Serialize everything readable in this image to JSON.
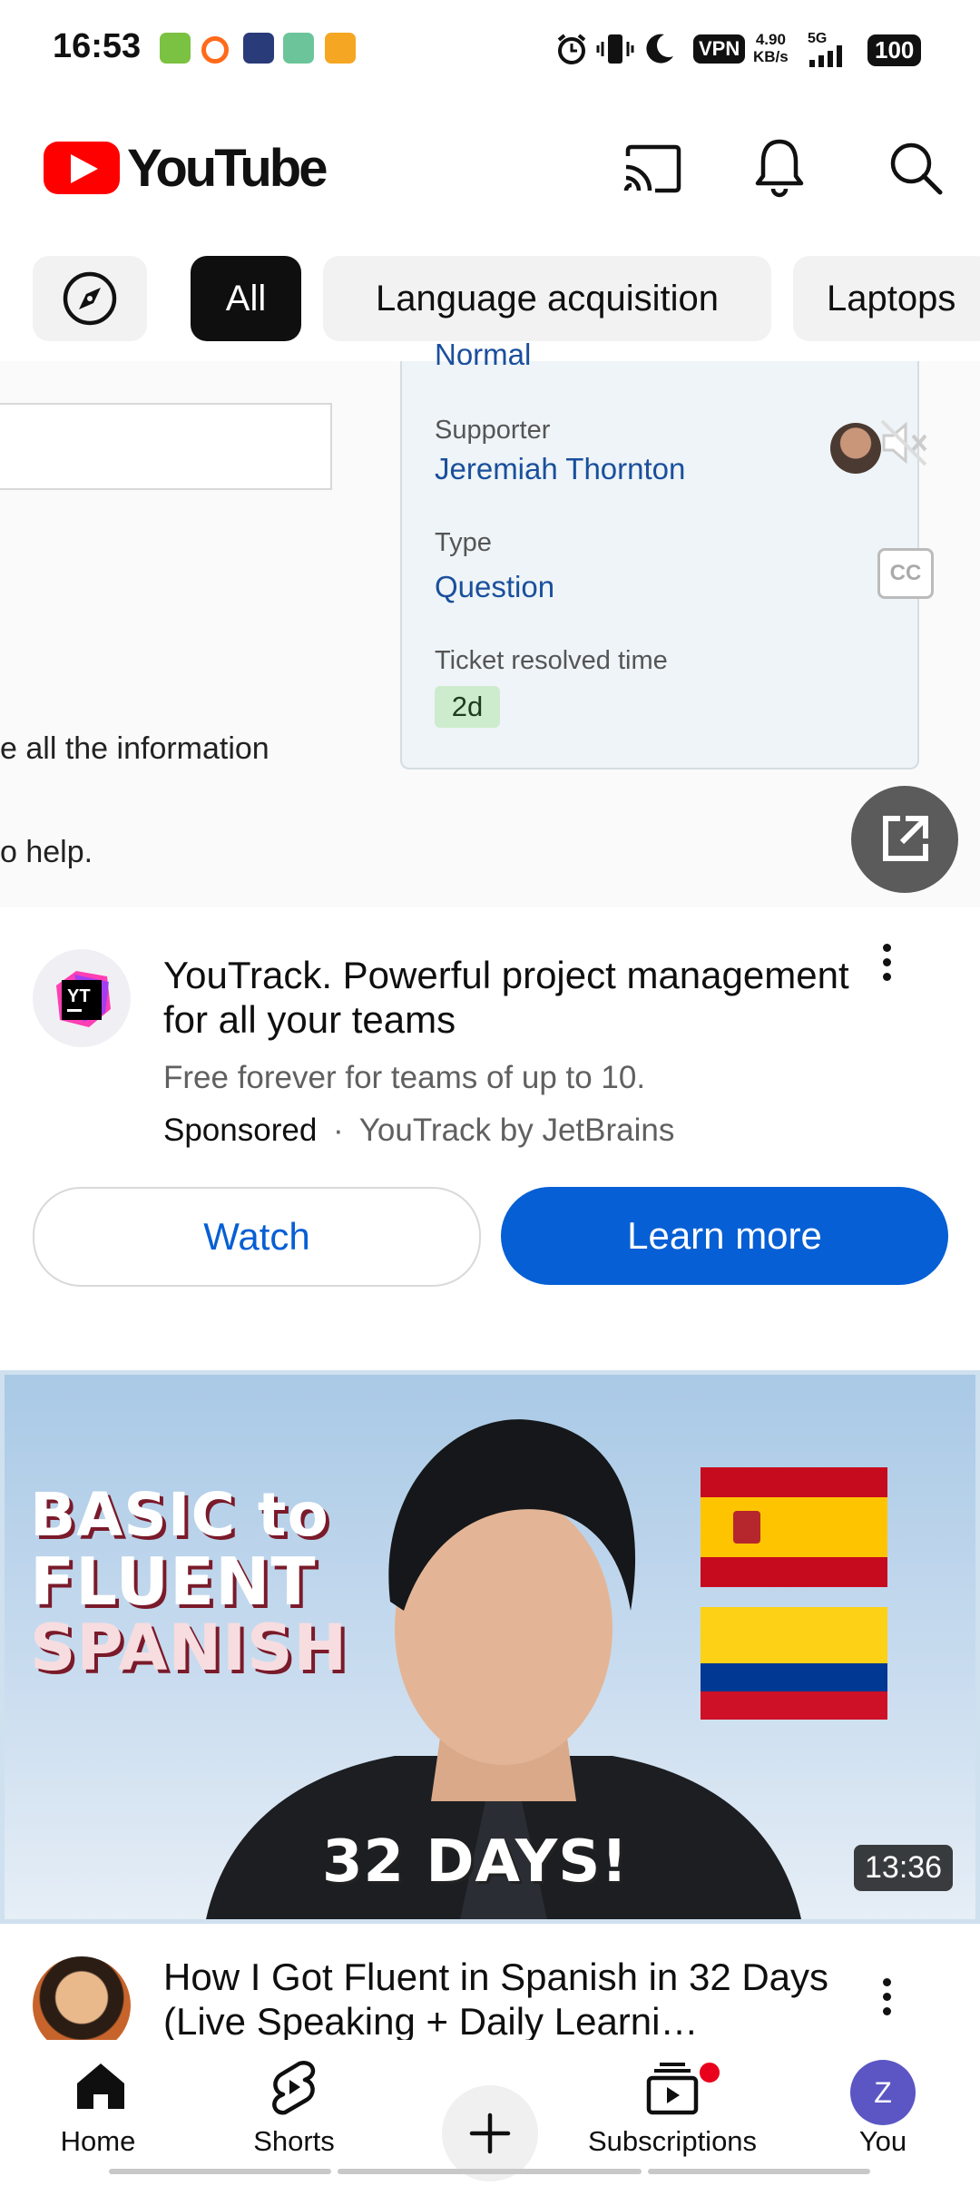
{
  "status_bar": {
    "time": "16:53",
    "vpn": "VPN",
    "speed_value": "4.90",
    "speed_unit": "KB/s",
    "network": "5G",
    "battery": "100"
  },
  "header": {
    "logo_text": "YouTube"
  },
  "chips": [
    "All",
    "Language acquisition",
    "Laptops"
  ],
  "ad": {
    "partial_top": "Normal",
    "info_line_1": "e all the information",
    "info_line_2": "o help.",
    "supporter_label": "Supporter",
    "supporter_value": "Jeremiah Thornton",
    "type_label": "Type",
    "type_value": "Question",
    "resolved_label": "Ticket resolved time",
    "resolved_value": "2d",
    "cc_label": "CC",
    "logo_text": "YT",
    "title": "YouTrack. Powerful project management for all your teams",
    "description": "Free forever for teams of up to 10.",
    "sponsored": "Sponsored",
    "separator": "·",
    "advertiser": "YouTrack by JetBrains",
    "watch_label": "Watch",
    "learn_more_label": "Learn more"
  },
  "video": {
    "thumb_line_1": "BASIC to",
    "thumb_line_2": "FLUENT",
    "thumb_line_3": "SPANISH",
    "thumb_days": "32 DAYS!",
    "duration": "13:36",
    "title": "How I Got Fluent in Spanish in 32 Days (Live Speaking + Daily Learni…"
  },
  "bottom_nav": {
    "home": "Home",
    "shorts": "Shorts",
    "subscriptions": "Subscriptions",
    "you": "You",
    "you_initial": "Z"
  },
  "colors": {
    "brand_red": "#ff0000",
    "link_blue": "#065fd4",
    "chip_active": "#0f0f0f"
  }
}
